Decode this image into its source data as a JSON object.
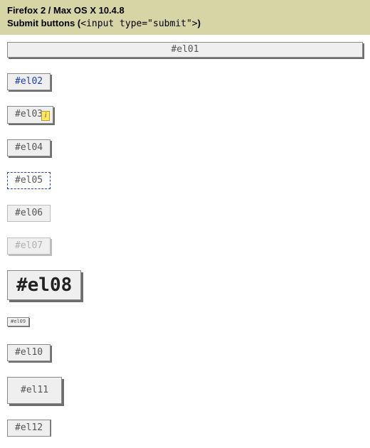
{
  "header": {
    "line1": "Firefox 2 / Max OS X 10.4.8",
    "line2_prefix": "Submit buttons (",
    "line2_code": "<input type=\"submit\">",
    "line2_suffix": ")"
  },
  "buttons": {
    "el01": "#el01",
    "el02": "#el02",
    "el03": "#el03",
    "el03_badge": "i",
    "el04": "#el04",
    "el05": "#el05",
    "el06": "#el06",
    "el07": "#el07",
    "el08": "#el08",
    "el09": "#el09",
    "el10": "#el10",
    "el11": "#el11",
    "el12": "#el12"
  }
}
